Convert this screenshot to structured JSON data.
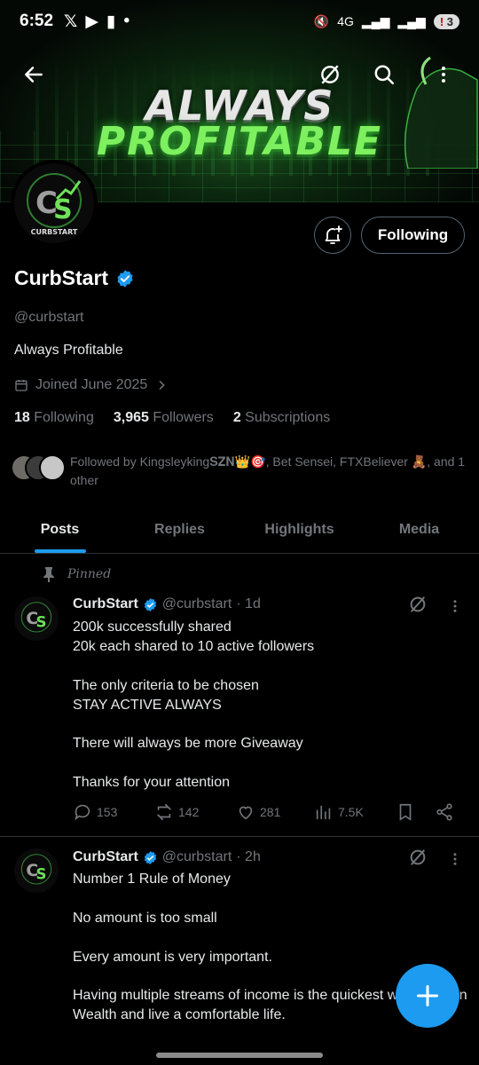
{
  "status": {
    "time": "6:52",
    "network": "4G",
    "battery": "3"
  },
  "banner": {
    "line1": "ALWAYS",
    "line2": "PROFITABLE"
  },
  "avatar": {
    "logo_letters": "CS",
    "logo_text": "CURBSTART"
  },
  "profile": {
    "name": "CurbStart",
    "handle": "@curbstart",
    "bio": "Always Profitable",
    "joined": "Joined June 2025",
    "following_count": "18",
    "following_label": "Following",
    "followers_count": "3,965",
    "followers_label": "Followers",
    "subscriptions_count": "2",
    "subscriptions_label": "Subscriptions",
    "followed_by": "Followed by Kingsleyking𝐒𝐙𝐍👑🎯, Bet Sensei, FTXBeliever 🧸, and 1 other",
    "follow_button": "Following"
  },
  "tabs": [
    {
      "label": "Posts"
    },
    {
      "label": "Replies"
    },
    {
      "label": "Highlights"
    },
    {
      "label": "Media"
    }
  ],
  "posts": [
    {
      "pinned_label": "Pinned",
      "name": "CurbStart",
      "handle": "@curbstart",
      "time": "· 1d",
      "text": "200k successfully shared\n20k each shared to 10 active followers\n\nThe only criteria to be chosen\nSTAY ACTIVE ALWAYS\n\nThere will always be more Giveaway\n\nThanks for your attention",
      "replies": "153",
      "reposts": "142",
      "likes": "281",
      "views": "7.5K"
    },
    {
      "name": "CurbStart",
      "handle": "@curbstart",
      "time": "· 2h",
      "text": "Number 1 Rule of Money\n\nNo amount is too small\n\nEvery amount is very important.\n\nHaving multiple streams of income is the quickest way to attain Wealth and live a comfortable life."
    }
  ],
  "colors": {
    "accent": "#1d9bf0",
    "banner_green": "#7ef05f",
    "muted": "#71767b"
  }
}
